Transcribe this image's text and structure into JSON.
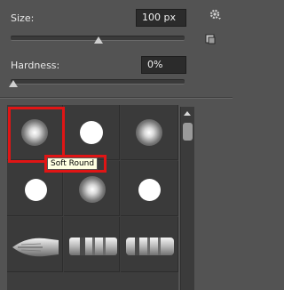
{
  "size": {
    "label": "Size:",
    "value": "100 px"
  },
  "hardness": {
    "label": "Hardness:",
    "value": "0%"
  },
  "tooltip": "Soft Round",
  "icons": {
    "gear": "gear-icon",
    "new_preset": "new-preset-icon",
    "scroll_up": "scroll-up-arrow-icon"
  },
  "brushes": [
    {
      "type": "soft-round"
    },
    {
      "type": "hard-round"
    },
    {
      "type": "soft-round"
    },
    {
      "type": "hard-round"
    },
    {
      "type": "soft-round"
    },
    {
      "type": "hard-round"
    },
    {
      "type": "bristle-tip"
    },
    {
      "type": "bristle-flat"
    },
    {
      "type": "bristle-flat"
    }
  ],
  "colors": {
    "selection": "#e01515",
    "panel": "#535353",
    "tooltip_bg": "#ffffe1"
  }
}
